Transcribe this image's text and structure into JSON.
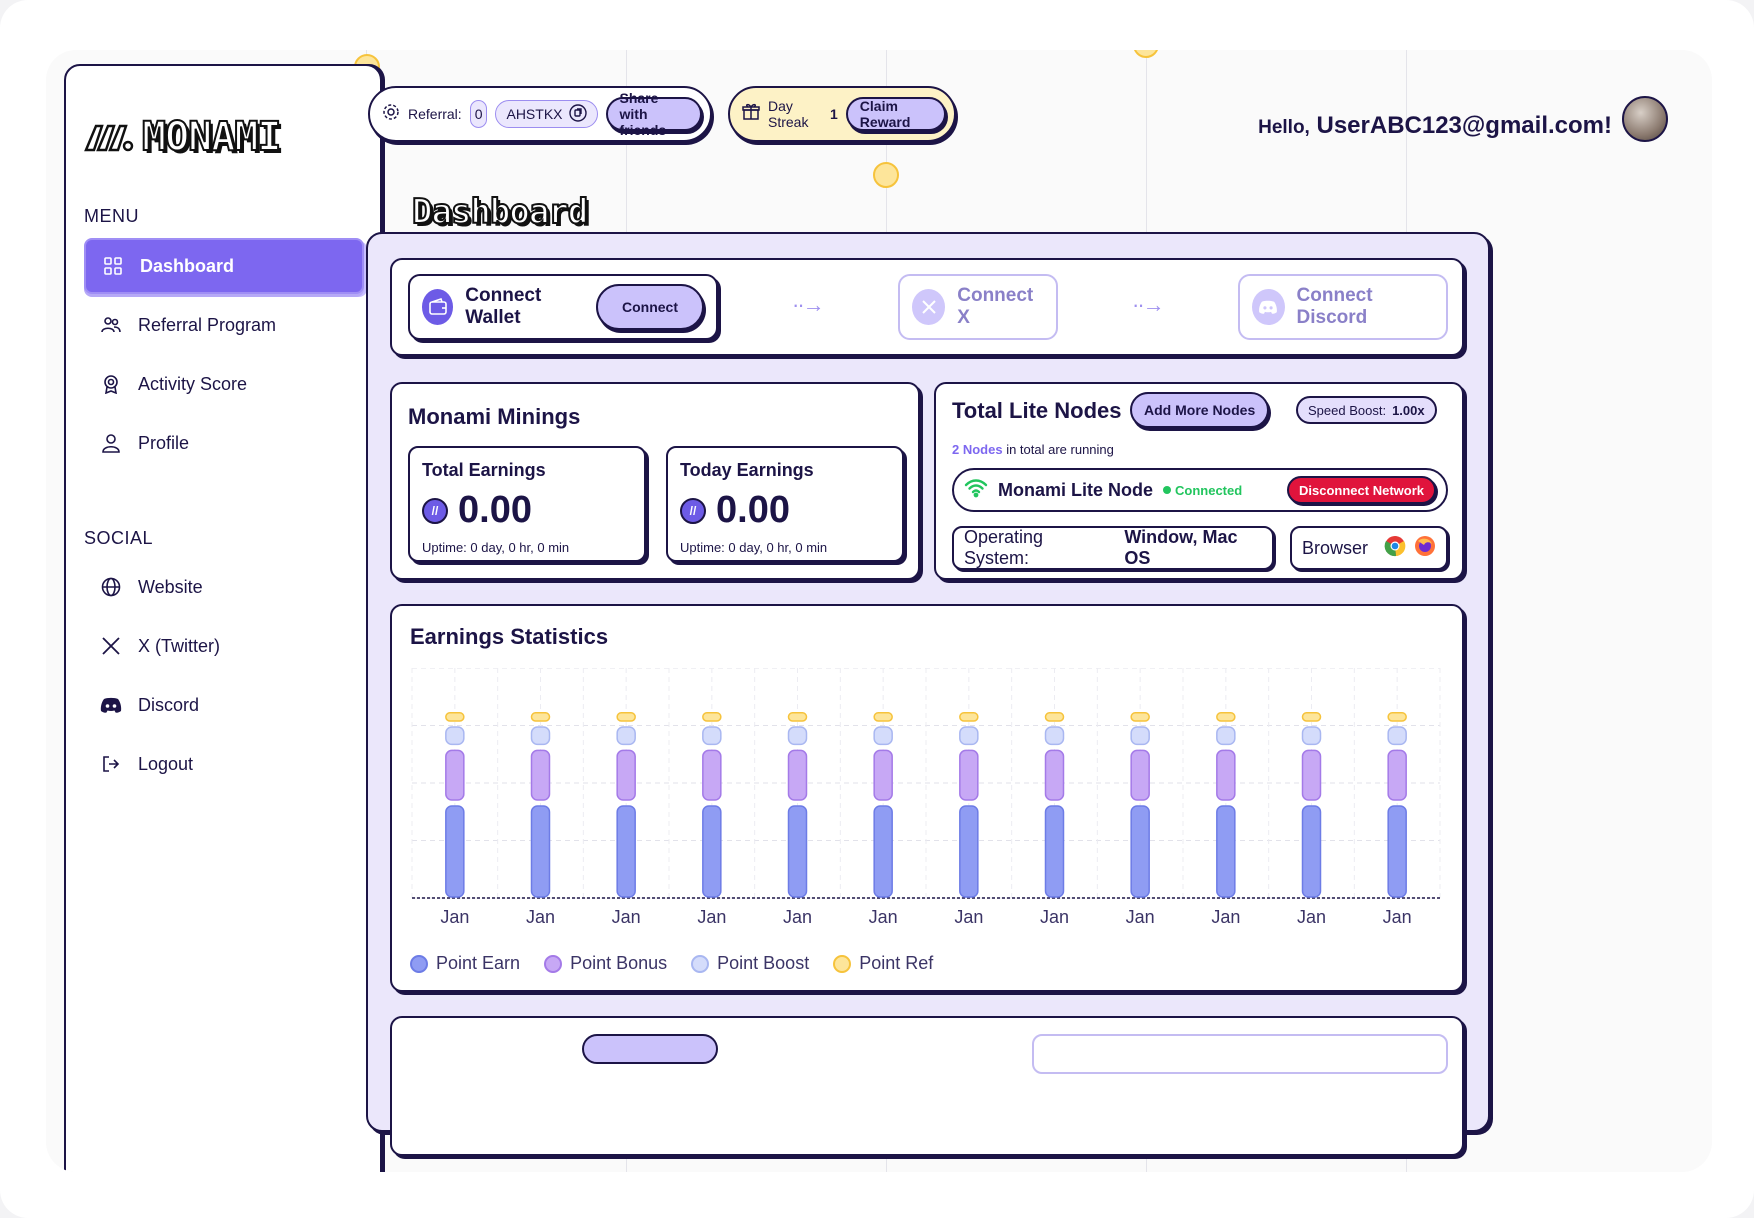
{
  "brand": {
    "name": "MONAMI"
  },
  "sidebar": {
    "menu_label": "MENU",
    "menu_items": [
      {
        "label": "Dashboard",
        "icon": "grid-icon",
        "active": true
      },
      {
        "label": "Referral Program",
        "icon": "users-icon",
        "active": false
      },
      {
        "label": "Activity Score",
        "icon": "award-icon",
        "active": false
      },
      {
        "label": "Profile",
        "icon": "user-icon",
        "active": false
      }
    ],
    "social_label": "SOCIAL",
    "social_items": [
      {
        "label": "Website",
        "icon": "globe-icon"
      },
      {
        "label": "X (Twitter)",
        "icon": "x-icon"
      },
      {
        "label": "Discord",
        "icon": "discord-icon"
      },
      {
        "label": "Logout",
        "icon": "logout-icon"
      }
    ]
  },
  "topbar": {
    "referral_label": "Referral:",
    "referral_count": "0",
    "referral_code": "AHSTKX",
    "share_label": "Share with friends",
    "streak_label": "Day Streak",
    "streak_value": "1",
    "claim_label": "Claim Reward",
    "greeting": "Hello,",
    "user_email": "UserABC123@gmail.com!"
  },
  "page_title": "Dashboard",
  "connect": {
    "wallet_label": "Connect Wallet",
    "wallet_button": "Connect",
    "x_label": "Connect X",
    "discord_label": "Connect Discord"
  },
  "minings": {
    "title": "Monami Minings",
    "total": {
      "label": "Total Earnings",
      "value": "0.00",
      "uptime": "Uptime: 0 day, 0 hr, 0 min"
    },
    "today": {
      "label": "Today Earnings",
      "value": "0.00",
      "uptime": "Uptime: 0 day, 0 hr, 0 min"
    }
  },
  "nodes": {
    "title": "Total Lite Nodes",
    "add_button": "Add More Nodes",
    "speed_label": "Speed Boost:",
    "speed_value": "1.00x",
    "count_text": "2 Nodes",
    "running_text": "in total are running",
    "node_name": "Monami Lite Node",
    "status": "Connected",
    "disconnect_button": "Disconnect Network",
    "os_label": "Operating System:",
    "os_value": "Window, Mac OS",
    "browser_label": "Browser"
  },
  "stats": {
    "title": "Earnings Statistics"
  },
  "colors": {
    "accent": "#7d67f0",
    "point_earn": "#8f9cf3",
    "point_bonus": "#c7a8f5",
    "point_boost": "#d4dcfb",
    "point_ref": "#fde59a",
    "connected": "#22c55e",
    "danger": "#e0143c"
  },
  "chart_data": {
    "type": "bar",
    "title": "Earnings Statistics",
    "categories": [
      "Jan",
      "Jan",
      "Jan",
      "Jan",
      "Jan",
      "Jan",
      "Jan",
      "Jan",
      "Jan",
      "Jan",
      "Jan",
      "Jan"
    ],
    "series": [
      {
        "name": "Point Earn",
        "values": [
          4,
          4,
          4,
          4,
          4,
          4,
          4,
          4,
          4,
          4,
          4,
          4
        ]
      },
      {
        "name": "Point Bonus",
        "values": [
          2.2,
          2.2,
          2.2,
          2.2,
          2.2,
          2.2,
          2.2,
          2.2,
          2.2,
          2.2,
          2.2,
          2.2
        ]
      },
      {
        "name": "Point Boost",
        "values": [
          0.8,
          0.8,
          0.8,
          0.8,
          0.8,
          0.8,
          0.8,
          0.8,
          0.8,
          0.8,
          0.8,
          0.8
        ]
      },
      {
        "name": "Point Ref",
        "values": [
          0.4,
          0.4,
          0.4,
          0.4,
          0.4,
          0.4,
          0.4,
          0.4,
          0.4,
          0.4,
          0.4,
          0.4
        ]
      }
    ],
    "ylim": [
      0,
      10
    ],
    "stacked": true,
    "grid": true,
    "legend": "bottom-left"
  }
}
